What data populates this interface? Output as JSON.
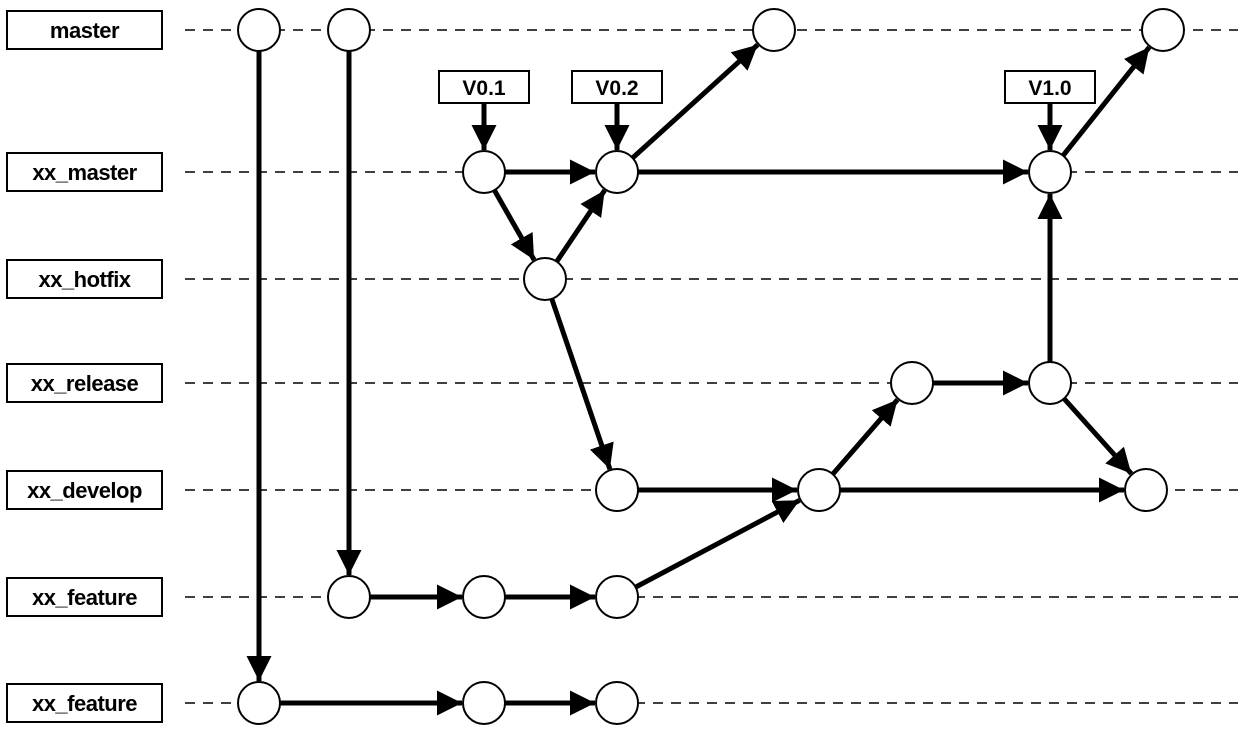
{
  "diagram": {
    "type": "git-branch-flow",
    "colors": {
      "stroke": "#000000",
      "node_fill": "#ffffff",
      "background": "#ffffff"
    },
    "lanes": [
      {
        "id": "master",
        "label": "master"
      },
      {
        "id": "xx_master",
        "label": "xx_master"
      },
      {
        "id": "xx_hotfix",
        "label": "xx_hotfix"
      },
      {
        "id": "xx_release",
        "label": "xx_release"
      },
      {
        "id": "xx_develop",
        "label": "xx_develop"
      },
      {
        "id": "xx_feature_a",
        "label": "xx_feature"
      },
      {
        "id": "xx_feature_b",
        "label": "xx_feature"
      }
    ],
    "nodes": [
      {
        "id": "m1",
        "lane": "master",
        "step": 0
      },
      {
        "id": "m2",
        "lane": "master",
        "step": 1
      },
      {
        "id": "m3",
        "lane": "master",
        "step": 5
      },
      {
        "id": "m4",
        "lane": "master",
        "step": 9
      },
      {
        "id": "xm1",
        "lane": "xx_master",
        "step": 2
      },
      {
        "id": "xm2",
        "lane": "xx_master",
        "step": 4
      },
      {
        "id": "xm3",
        "lane": "xx_master",
        "step": 8
      },
      {
        "id": "h1",
        "lane": "xx_hotfix",
        "step": 3
      },
      {
        "id": "r1",
        "lane": "xx_release",
        "step": 7
      },
      {
        "id": "r2",
        "lane": "xx_release",
        "step": 8
      },
      {
        "id": "d1",
        "lane": "xx_develop",
        "step": 4
      },
      {
        "id": "d2",
        "lane": "xx_develop",
        "step": 6
      },
      {
        "id": "d3",
        "lane": "xx_develop",
        "step": 9
      },
      {
        "id": "fa1",
        "lane": "xx_feature_a",
        "step": 1
      },
      {
        "id": "fa2",
        "lane": "xx_feature_a",
        "step": 2
      },
      {
        "id": "fa3",
        "lane": "xx_feature_a",
        "step": 4
      },
      {
        "id": "fb1",
        "lane": "xx_feature_b",
        "step": 0
      },
      {
        "id": "fb2",
        "lane": "xx_feature_b",
        "step": 2
      },
      {
        "id": "fb3",
        "lane": "xx_feature_b",
        "step": 4
      }
    ],
    "edges": [
      {
        "from": "m1",
        "to": "fb1"
      },
      {
        "from": "m2",
        "to": "fa1"
      },
      {
        "from": "xm1",
        "to": "xm2"
      },
      {
        "from": "xm1",
        "to": "h1"
      },
      {
        "from": "h1",
        "to": "xm2"
      },
      {
        "from": "h1",
        "to": "d1"
      },
      {
        "from": "xm2",
        "to": "m3"
      },
      {
        "from": "xm2",
        "to": "xm3"
      },
      {
        "from": "xm3",
        "to": "m4"
      },
      {
        "from": "d1",
        "to": "d2"
      },
      {
        "from": "d2",
        "to": "r1"
      },
      {
        "from": "d2",
        "to": "d3"
      },
      {
        "from": "r1",
        "to": "r2"
      },
      {
        "from": "r2",
        "to": "xm3"
      },
      {
        "from": "r2",
        "to": "d3"
      },
      {
        "from": "fa1",
        "to": "fa2"
      },
      {
        "from": "fa2",
        "to": "fa3"
      },
      {
        "from": "fa3",
        "to": "d2"
      },
      {
        "from": "fb1",
        "to": "fb2"
      },
      {
        "from": "fb2",
        "to": "fb3"
      }
    ],
    "tags": [
      {
        "label": "V0.1",
        "node": "xm1"
      },
      {
        "label": "V0.2",
        "node": "xm2"
      },
      {
        "label": "V1.0",
        "node": "xm3"
      }
    ]
  }
}
